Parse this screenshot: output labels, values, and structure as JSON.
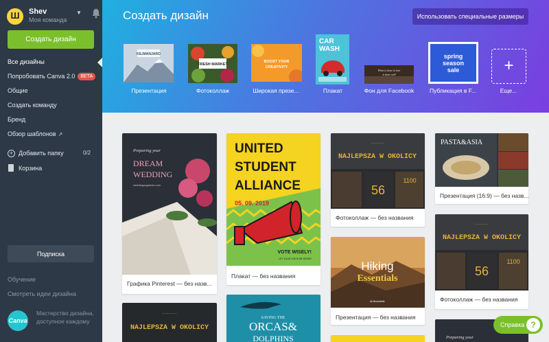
{
  "team": {
    "name": "Shev",
    "subtitle": "Моя команда"
  },
  "sidebar": {
    "create_label": "Создать дизайн",
    "items": [
      {
        "label": "Все дизайны"
      },
      {
        "label": "Попробовать Canva 2.0",
        "badge": "BETA"
      },
      {
        "label": "Общие"
      },
      {
        "label": "Создать команду"
      },
      {
        "label": "Бренд"
      },
      {
        "label": "Обзор шаблонов"
      }
    ],
    "add_folder": {
      "label": "Добавить папку",
      "count": "0/2"
    },
    "trash_label": "Корзина",
    "subscribe_label": "Подписка",
    "learn_label": "Обучение",
    "ideas_label": "Смотреть идеи дизайна",
    "promo_logo": "Canva",
    "promo_text": "Мастерство дизайна, доступное каждому"
  },
  "header": {
    "title": "Создать дизайн",
    "custom_size_label": "Использовать специальные размеры",
    "templates": [
      {
        "label": "Презентация",
        "thumb_text": "KILIMANJARO"
      },
      {
        "label": "Фотоколлаж",
        "thumb_text": "FRESH MARKET"
      },
      {
        "label": "Широкая презе...",
        "thumb_text": "BOOST YOUR CREATIVITY"
      },
      {
        "label": "Плакат",
        "thumb_text": "CAR WASH"
      },
      {
        "label": "Фон для Facebook",
        "thumb_text": "What is done in love is done well"
      },
      {
        "label": "Публикация в F...",
        "thumb_text": "spring season sale"
      }
    ],
    "more_label": "Еще..."
  },
  "designs": {
    "col1": [
      {
        "label": "Графика Pinterest — без назв...",
        "t1": "Preparing your",
        "t2": "DREAM",
        "t3": "WEDDING",
        "t4": "weddingorganizer.com"
      },
      {
        "label": "",
        "t1": "NAJLEPSZA W OKOLICY"
      }
    ],
    "col2": [
      {
        "label": "Плакат — без названия",
        "t1": "UNITED",
        "t2": "STUDENT",
        "t3": "ALLIANCE",
        "t4": "05. 09. 2019",
        "t5": "VOTE WISELY!",
        "t6": "LET YOUR VOICE BE HEARD"
      },
      {
        "label": "",
        "t1": "SAVING THE",
        "t2": "ORCAS&",
        "t3": "DOLPHINS"
      }
    ],
    "col3": [
      {
        "label": "Фотоколлаж — без названия",
        "t1": "NAJLEPSZA W OKOLICY",
        "t2": "56",
        "t3": "1100"
      },
      {
        "label": "Презентация — без названия",
        "t1": "Hiking",
        "t2": "Essentials",
        "t3": "#Lifeoutside"
      }
    ],
    "col4": [
      {
        "label": "Презентация (16:9) — без назв...",
        "t1": "PASTA&ASIA"
      },
      {
        "label": "Фотоколлаж — без названия",
        "t1": "NAJLEPSZA W OKOLICY",
        "t2": "56",
        "t3": "1100"
      },
      {
        "label": "",
        "t1": "Preparing your"
      }
    ]
  },
  "help_label": "Справка",
  "colors": {
    "sidebar": "#2e3947",
    "accent_green": "#7bc02c",
    "header_from": "#1fb0e0",
    "header_to": "#7a3ee0"
  }
}
